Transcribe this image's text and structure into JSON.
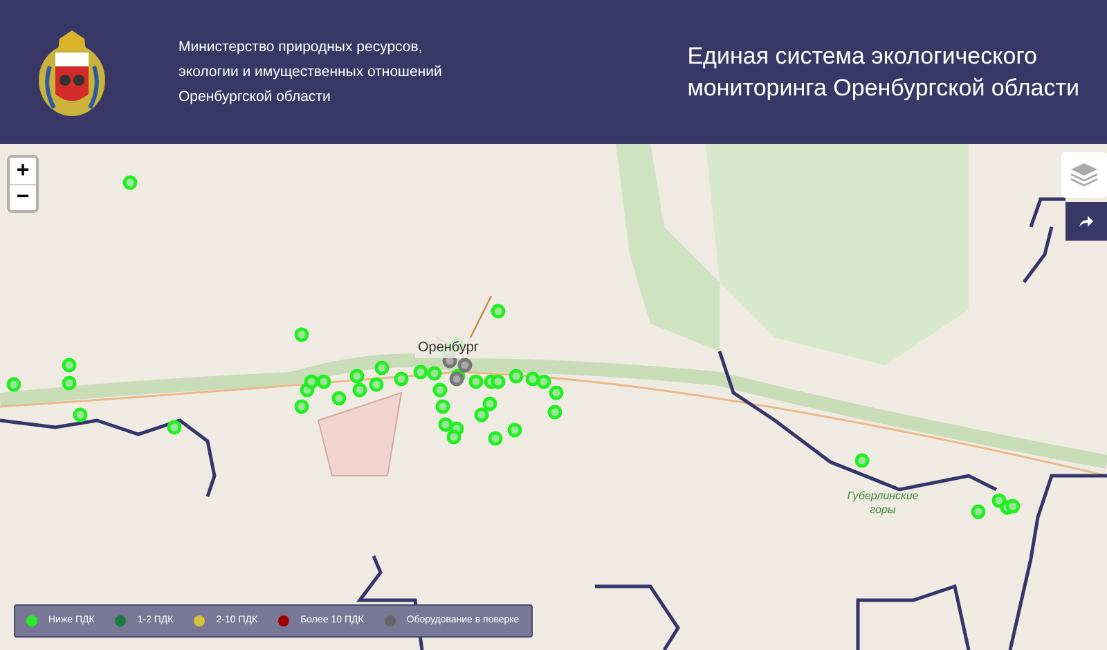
{
  "header": {
    "ministry": [
      "Министерство природных ресурсов,",
      "экологии и имущественных отношений",
      "Оренбургской области"
    ],
    "title": [
      "Единая система экологического",
      "мониторинга Оренбургской области"
    ]
  },
  "map": {
    "zoom_in": "+",
    "zoom_out": "−",
    "labels": [
      {
        "kind": "city",
        "text": "Оренбург"
      },
      {
        "kind": "area",
        "text": "Губерлинские горы"
      }
    ]
  },
  "legend": [
    {
      "label": "Ниже ПДК",
      "color": "#22ee22"
    },
    {
      "label": "1-2 ПДК",
      "color": "#1a7a40"
    },
    {
      "label": "2-10 ПДК",
      "color": "#d4c43a"
    },
    {
      "label": "Более 10 ПДК",
      "color": "#a00000"
    },
    {
      "label": "Оборудование в поверке",
      "color": "#666666"
    }
  ]
}
